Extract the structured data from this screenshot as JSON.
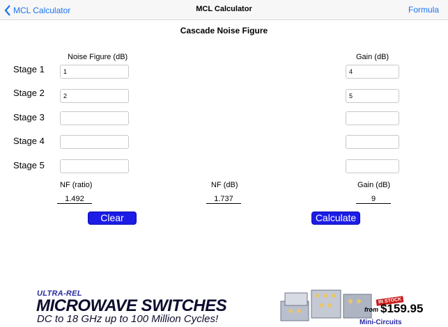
{
  "navbar": {
    "back_label": "MCL Calculator",
    "title": "MCL Calculator",
    "formula_label": "Formula"
  },
  "heading": "Cascade Noise Figure",
  "columns": {
    "noise_figure": "Noise Figure (dB)",
    "gain": "Gain (dB)"
  },
  "stages": [
    {
      "label": "Stage 1",
      "nf": "1",
      "gain": "4"
    },
    {
      "label": "Stage 2",
      "nf": "2",
      "gain": "5"
    },
    {
      "label": "Stage 3",
      "nf": "",
      "gain": ""
    },
    {
      "label": "Stage 4",
      "nf": "",
      "gain": ""
    },
    {
      "label": "Stage 5",
      "nf": "",
      "gain": ""
    }
  ],
  "results": {
    "nf_ratio_label": "NF (ratio)",
    "nf_ratio_value": "1.492",
    "nf_db_label": "NF (dB)",
    "nf_db_value": "1.737",
    "gain_label": "Gain (dB)",
    "gain_value": "9"
  },
  "buttons": {
    "clear": "Clear",
    "calculate": "Calculate"
  },
  "ad": {
    "line1": "ULTRA-REL",
    "line2": "MICROWAVE SWITCHES",
    "line3": "DC to 18 GHz  up to 100 Million Cycles!",
    "in_stock": "IN STOCK",
    "from": "from",
    "price": "$159.95",
    "brand": "Mini-Circuits"
  },
  "colors": {
    "accent": "#1a73f0",
    "button": "#1c1ce6"
  }
}
